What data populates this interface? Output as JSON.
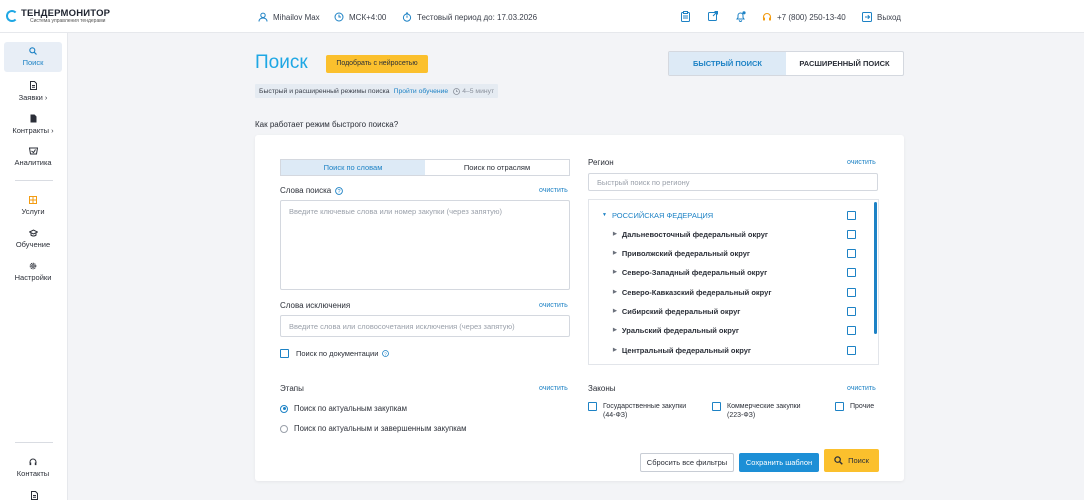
{
  "topbar": {
    "logo_title": "ТЕНДЕРМОНИТОР",
    "logo_sub": "Система управления тендерами",
    "user": "Mihailov Max",
    "timezone": "МСК+4:00",
    "trial": "Тестовый период до: 17.03.2026",
    "phone": "+7 (800) 250-13-40",
    "logout": "Выход"
  },
  "sidebar": {
    "items": [
      {
        "label": "Поиск",
        "icon": "search-icon"
      },
      {
        "label": "Заявки ›",
        "icon": "document-icon"
      },
      {
        "label": "Контракты ›",
        "icon": "contract-icon"
      },
      {
        "label": "Аналитика",
        "icon": "analytics-icon"
      },
      {
        "label": "Услуги",
        "icon": "services-icon"
      },
      {
        "label": "Обучение",
        "icon": "education-icon"
      },
      {
        "label": "Настройки",
        "icon": "gear-icon"
      },
      {
        "label": "Контакты",
        "icon": "headset-icon"
      }
    ]
  },
  "page": {
    "title": "Поиск",
    "ai_button": "Подобрать с нейросетью",
    "mode_quick": "БЫСТРЫЙ ПОИСК",
    "mode_advanced": "РАСШИРЕННЫЙ ПОИСК",
    "hint_text": "Быстрый и расширенный режимы поиска",
    "hint_link": "Пройти обучение",
    "hint_time": "4–5 минут",
    "how_text": "Как работает режим быстрого поиска?"
  },
  "form": {
    "tab_words": "Поиск по словам",
    "tab_industries": "Поиск по отраслям",
    "keywords_label": "Слова поиска",
    "keywords_clear": "очистить",
    "keywords_placeholder": "Введите ключевые слова или номер закупки (через запятую)",
    "exclude_label": "Слова исключения",
    "exclude_clear": "очистить",
    "exclude_placeholder": "Введите слова или словосочетания исключения (через запятую)",
    "docs_checkbox": "Поиск по документации",
    "region_label": "Регион",
    "region_clear": "очистить",
    "region_placeholder": "Быстрый поиск по региону",
    "regions": [
      "РОССИЙСКАЯ ФЕДЕРАЦИЯ",
      "Дальневосточный федеральный округ",
      "Приволжский федеральный округ",
      "Северо-Западный федеральный округ",
      "Северо-Кавказский федеральный округ",
      "Сибирский федеральный округ",
      "Уральский федеральный округ",
      "Центральный федеральный округ"
    ],
    "stages_label": "Этапы",
    "stages_clear": "очистить",
    "stage_current": "Поиск по актуальным закупкам",
    "stage_all": "Поиск по актуальным и завершенным закупкам",
    "laws_label": "Законы",
    "laws_clear": "очистить",
    "law_gov_1": "Государственные закупки",
    "law_gov_2": "(44-ФЗ)",
    "law_com_1": "Коммерческие закупки",
    "law_com_2": "(223-ФЗ)",
    "law_other": "Прочие",
    "reset_button": "Сбросить все фильтры",
    "save_button": "Сохранить шаблон",
    "search_button": "Поиск"
  },
  "colors": {
    "accent": "#1ea7e4",
    "link": "#1d82c5",
    "yellow": "#fbc02d"
  }
}
